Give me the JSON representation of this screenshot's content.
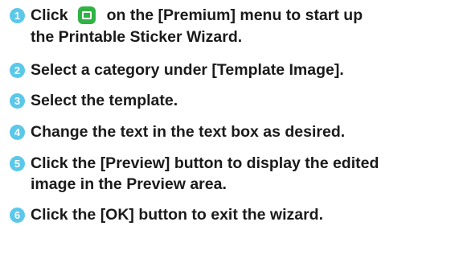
{
  "accent_color": "#5bc8ea",
  "icon_color": "#2fb344",
  "steps": [
    {
      "number": "1",
      "text_before": "Click",
      "icon": "printable-sticker-icon",
      "text_after": "on the [Premium] menu to start up",
      "text_line2": "the Printable Sticker Wizard."
    },
    {
      "number": "2",
      "text": "Select a category under [Template Image]."
    },
    {
      "number": "3",
      "text": "Select the template."
    },
    {
      "number": "4",
      "text": "Change the text in the text box as desired."
    },
    {
      "number": "5",
      "text": "Click the [Preview] button to display the edited",
      "text_line2": "image in the Preview area."
    },
    {
      "number": "6",
      "text": "Click the [OK] button to exit the wizard."
    }
  ]
}
